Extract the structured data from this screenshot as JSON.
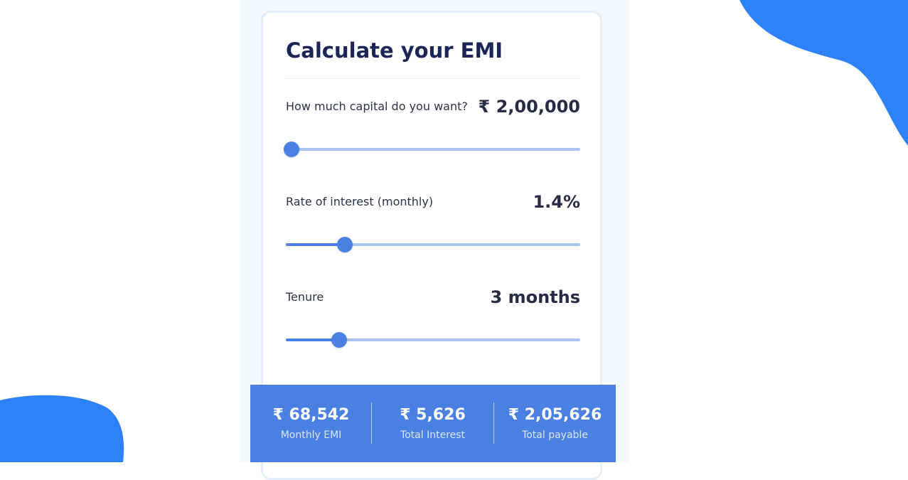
{
  "theme": {
    "accent": "#4a80e2",
    "blob": "#2d82fa",
    "title_color": "#1b2558",
    "track_color": "#aac4f0"
  },
  "calculator": {
    "title": "Calculate your EMI",
    "fields": [
      {
        "label": "How much capital do you want?",
        "value": "₹ 2,00,000",
        "slider_fraction": 0.02
      },
      {
        "label": "Rate of interest (monthly)",
        "value": "1.4%",
        "slider_fraction": 0.2
      },
      {
        "label": "Tenure",
        "value": "3 months",
        "slider_fraction": 0.18
      }
    ]
  },
  "results": [
    {
      "amount": "₹ 68,542",
      "label": "Monthly EMI"
    },
    {
      "amount": "₹ 5,626",
      "label": "Total Interest"
    },
    {
      "amount": "₹ 2,05,626",
      "label": "Total payable"
    }
  ]
}
